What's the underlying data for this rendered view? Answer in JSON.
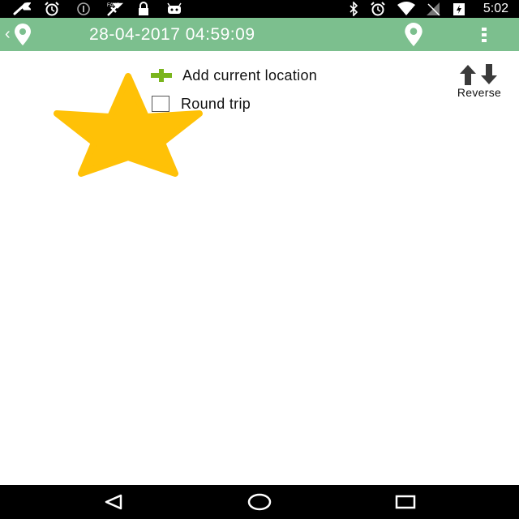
{
  "status_bar": {
    "time": "5:02",
    "left_icons": [
      "wrench-icon",
      "alarm-icon",
      "info-icon",
      "gps-fake-icon",
      "lock-icon",
      "android-icon"
    ],
    "right_icons": [
      "bluetooth-icon",
      "alarm-icon",
      "wifi-icon",
      "signal-icon",
      "battery-charging-icon"
    ]
  },
  "app_bar": {
    "title": "28-04-2017 04:59:09",
    "back_icon": "chevron-left-icon",
    "logo_icon": "map-pin-icon",
    "pin_icon": "map-pin-icon",
    "menu_icon": "overflow-menu-icon",
    "color": "#7cbf8e"
  },
  "content": {
    "add_location_label": "Add current location",
    "add_icon": "plus-icon",
    "add_icon_color": "#7ab51d",
    "round_trip_label": "Round trip",
    "round_trip_checked": false,
    "reverse_label": "Reverse",
    "reverse_icon": "swap-vertical-icon",
    "star_icon": "star-icon",
    "star_color": "#ffc107"
  },
  "nav_bar": {
    "buttons": [
      "back-triangle-icon",
      "home-circle-icon",
      "recents-square-icon"
    ]
  }
}
